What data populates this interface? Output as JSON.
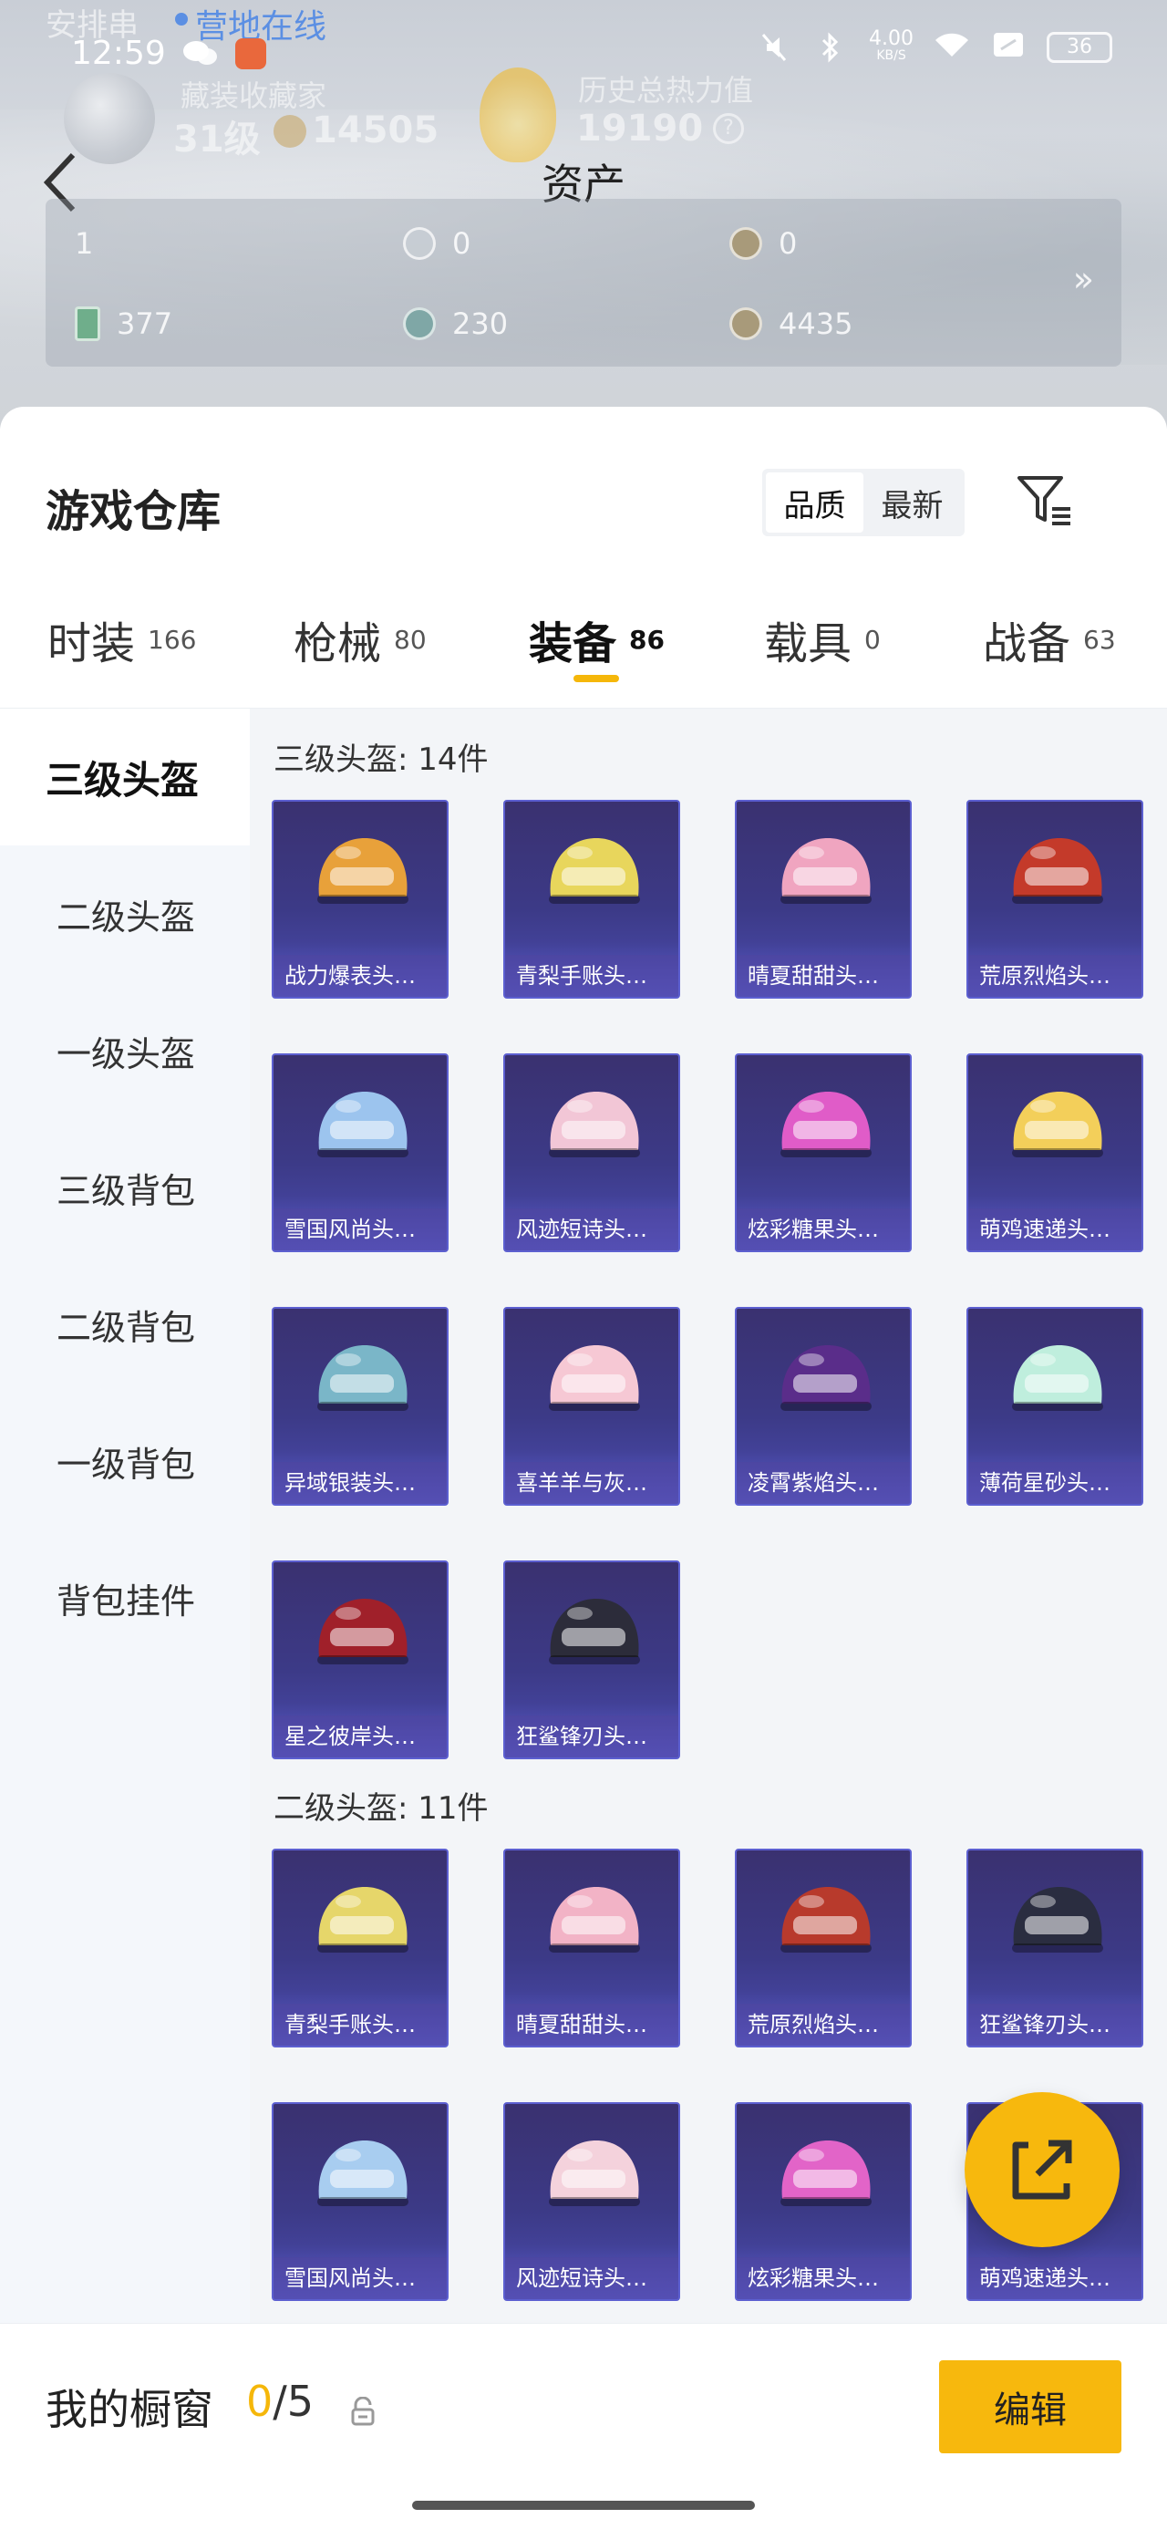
{
  "status_bar": {
    "time": "12:59",
    "notification": "营地在线",
    "faded_text": "安排串",
    "net_speed": "4.00",
    "net_unit": "KB/S",
    "battery": "36"
  },
  "profile_faded": {
    "label": "藏装收藏家",
    "level": "31级",
    "score": "14505",
    "history_label": "历史总热力值",
    "history_value": "19190",
    "help": "?"
  },
  "header": {
    "title": "资产"
  },
  "assets": [
    {
      "icon": "card-icon",
      "value": "1"
    },
    {
      "icon": "coin-icon",
      "value": "0"
    },
    {
      "icon": "gold-coin-icon",
      "value": "0"
    },
    {
      "icon": "green-card-icon",
      "value": "377"
    },
    {
      "icon": "teal-coin-icon",
      "value": "230"
    },
    {
      "icon": "bronze-coin-icon",
      "value": "4435"
    }
  ],
  "asset_more": "»",
  "warehouse": {
    "title": "游戏仓库",
    "sort_options": [
      "品质",
      "最新"
    ],
    "sort_active": "品质"
  },
  "tabs": [
    {
      "label": "时装",
      "count": "166"
    },
    {
      "label": "枪械",
      "count": "80"
    },
    {
      "label": "装备",
      "count": "86"
    },
    {
      "label": "载具",
      "count": "0"
    },
    {
      "label": "战备",
      "count": "63"
    }
  ],
  "tab_active": "装备",
  "sidebar": [
    "三级头盔",
    "二级头盔",
    "一级头盔",
    "三级背包",
    "二级背包",
    "一级背包",
    "背包挂件"
  ],
  "sidebar_active": "三级头盔",
  "groups": [
    {
      "title": "三级头盔: 14件",
      "items": [
        {
          "name": "战力爆表头…",
          "color": "#e8a13a"
        },
        {
          "name": "青梨手账头…",
          "color": "#e8d65c"
        },
        {
          "name": "晴夏甜甜头…",
          "color": "#f0a5c0"
        },
        {
          "name": "荒原烈焰头…",
          "color": "#c43a2a"
        },
        {
          "name": "雪国风尚头…",
          "color": "#9cc4ee"
        },
        {
          "name": "风迹短诗头…",
          "color": "#f2c6d6"
        },
        {
          "name": "炫彩糖果头…",
          "color": "#e05cc8"
        },
        {
          "name": "萌鸡速递头…",
          "color": "#f3cf5a"
        },
        {
          "name": "异域银装头…",
          "color": "#7ab6c8"
        },
        {
          "name": "喜羊羊与灰…",
          "color": "#f6c8d4"
        },
        {
          "name": "凌霄紫焰头…",
          "color": "#5a2d8a"
        },
        {
          "name": "薄荷星砂头…",
          "color": "#bfeedd"
        },
        {
          "name": "星之彼岸头…",
          "color": "#a0202a"
        },
        {
          "name": "狂鲨锋刃头…",
          "color": "#2c2c3a"
        }
      ]
    },
    {
      "title": "二级头盔: 11件",
      "items": [
        {
          "name": "青梨手账头…",
          "color": "#e6d66a"
        },
        {
          "name": "晴夏甜甜头…",
          "color": "#f2b3c6"
        },
        {
          "name": "荒原烈焰头…",
          "color": "#b83a2c"
        },
        {
          "name": "狂鲨锋刃头…",
          "color": "#2a2d40"
        },
        {
          "name": "雪国风尚头…",
          "color": "#a8cdf0"
        },
        {
          "name": "风迹短诗头…",
          "color": "#f4d2dc"
        },
        {
          "name": "炫彩糖果头…",
          "color": "#e264c8"
        },
        {
          "name": "萌鸡速递头…",
          "color": "#f1d06a"
        }
      ]
    }
  ],
  "showcase": {
    "label": "我的橱窗",
    "current": "0",
    "sep": "/",
    "total": "5"
  },
  "edit_button": "编辑",
  "colors": {
    "accent": "#f7b80d",
    "item_bg": "#3c3a87"
  }
}
